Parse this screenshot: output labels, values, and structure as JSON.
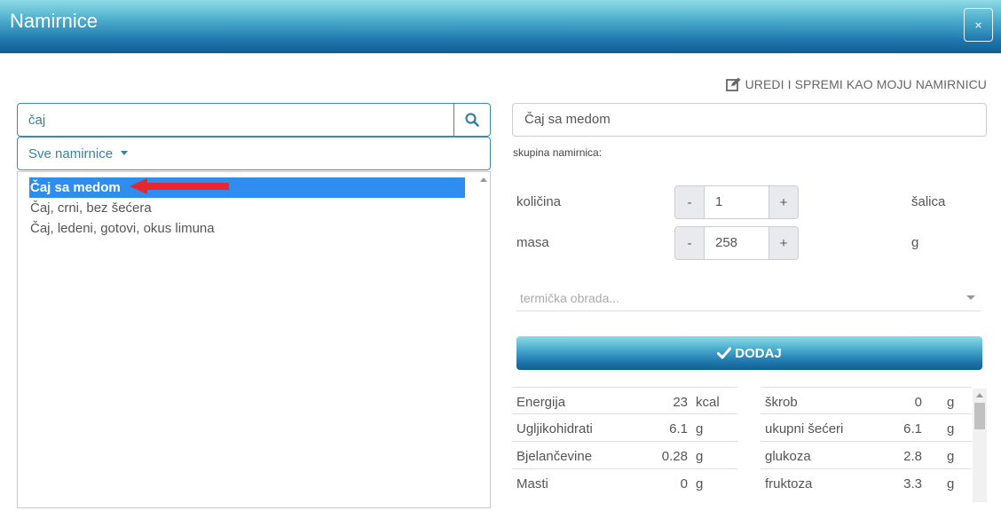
{
  "dialog": {
    "title": "Namirnice",
    "close_label": "×"
  },
  "edit_link": {
    "label": "UREDI I SPREMI KAO MOJU NAMIRNICU",
    "icon": "edit-icon"
  },
  "search": {
    "value": "čaj",
    "icon": "search-icon"
  },
  "filter": {
    "selected": "Sve namirnice"
  },
  "results": [
    {
      "label": "Čaj sa medom",
      "selected": true
    },
    {
      "label": "Čaj, crni, bez šećera",
      "selected": false
    },
    {
      "label": "Čaj, ledeni, gotovi, okus limuna",
      "selected": false
    }
  ],
  "detail": {
    "name": "Čaj sa medom",
    "group_label": "skupina namirnica:",
    "quantity": {
      "label": "količina",
      "value": "1",
      "unit": "šalica",
      "minus": "-",
      "plus": "+"
    },
    "mass": {
      "label": "masa",
      "value": "258",
      "unit": "g",
      "minus": "-",
      "plus": "+"
    },
    "thermal_placeholder": "termička obrada...",
    "add_label": "DODAJ"
  },
  "nutrition_left": [
    {
      "label": "Energija",
      "value": "23",
      "unit": "kcal"
    },
    {
      "label": "Ugljikohidrati",
      "value": "6.1",
      "unit": "g"
    },
    {
      "label": "Bjelančevine",
      "value": "0.28",
      "unit": "g"
    },
    {
      "label": "Masti",
      "value": "0",
      "unit": "g"
    }
  ],
  "nutrition_right": [
    {
      "label": "škrob",
      "value": "0",
      "unit": "g"
    },
    {
      "label": "ukupni šećeri",
      "value": "6.1",
      "unit": "g"
    },
    {
      "label": "glukoza",
      "value": "2.8",
      "unit": "g"
    },
    {
      "label": "fruktoza",
      "value": "3.3",
      "unit": "g"
    }
  ],
  "colors": {
    "accent": "#1f78ad",
    "selection": "#2f8df0",
    "annotation_arrow": "#e8262d"
  }
}
